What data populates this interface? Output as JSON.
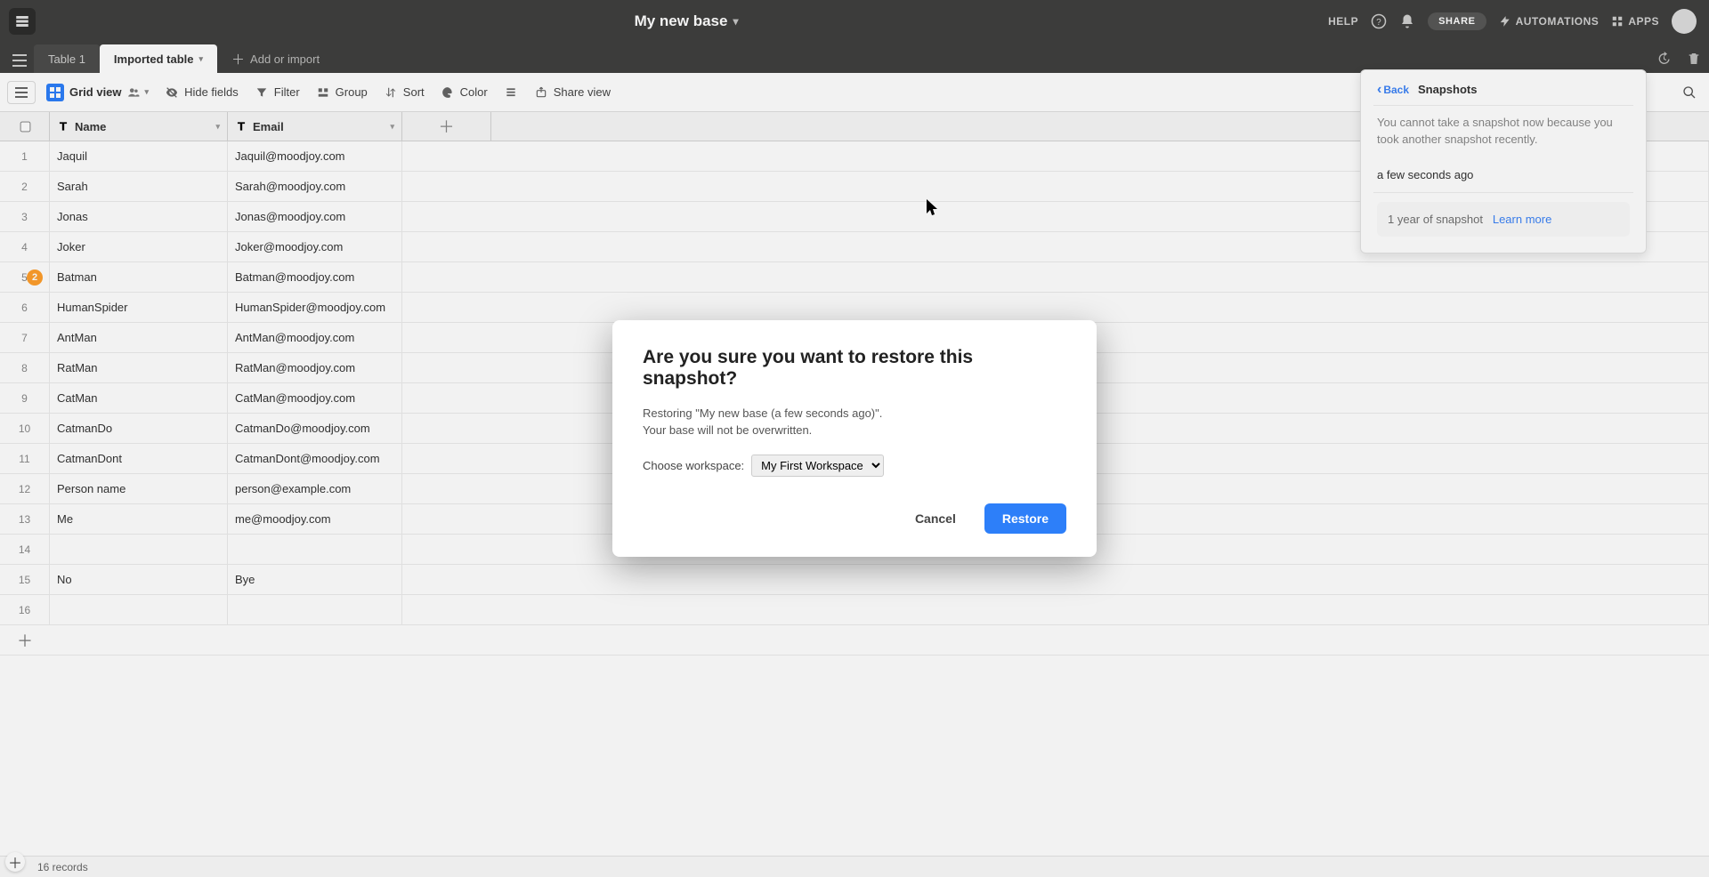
{
  "top": {
    "base_name": "My new base",
    "help": "HELP",
    "share": "SHARE",
    "automations": "AUTOMATIONS",
    "apps": "APPS"
  },
  "tabs": {
    "items": [
      {
        "label": "Table 1",
        "active": false
      },
      {
        "label": "Imported table",
        "active": true
      }
    ],
    "add_label": "Add or import"
  },
  "toolbar": {
    "view_name": "Grid view",
    "hide_fields": "Hide fields",
    "filter": "Filter",
    "group": "Group",
    "sort": "Sort",
    "color": "Color",
    "share_view": "Share view"
  },
  "columns": {
    "name": "Name",
    "email": "Email"
  },
  "rows": [
    {
      "n": 1,
      "name": "Jaquil",
      "email": "Jaquil@moodjoy.com"
    },
    {
      "n": 2,
      "name": "Sarah",
      "email": "Sarah@moodjoy.com"
    },
    {
      "n": 3,
      "name": "Jonas",
      "email": "Jonas@moodjoy.com"
    },
    {
      "n": 4,
      "name": "Joker",
      "email": "Joker@moodjoy.com"
    },
    {
      "n": 5,
      "name": "Batman",
      "email": "Batman@moodjoy.com",
      "badge": "2"
    },
    {
      "n": 6,
      "name": "HumanSpider",
      "email": "HumanSpider@moodjoy.com"
    },
    {
      "n": 7,
      "name": "AntMan",
      "email": "AntMan@moodjoy.com"
    },
    {
      "n": 8,
      "name": "RatMan",
      "email": "RatMan@moodjoy.com"
    },
    {
      "n": 9,
      "name": "CatMan",
      "email": "CatMan@moodjoy.com"
    },
    {
      "n": 10,
      "name": "CatmanDo",
      "email": "CatmanDo@moodjoy.com"
    },
    {
      "n": 11,
      "name": "CatmanDont",
      "email": "CatmanDont@moodjoy.com"
    },
    {
      "n": 12,
      "name": "Person name",
      "email": "person@example.com"
    },
    {
      "n": 13,
      "name": "Me",
      "email": "me@moodjoy.com"
    },
    {
      "n": 14,
      "name": "",
      "email": ""
    },
    {
      "n": 15,
      "name": "No",
      "email": "Bye"
    },
    {
      "n": 16,
      "name": "",
      "email": ""
    }
  ],
  "footer": {
    "records": "16 records"
  },
  "panel": {
    "back": "Back",
    "title": "Snapshots",
    "note": "You cannot take a snapshot now because you took another snapshot recently.",
    "timestamp": "a few seconds ago",
    "upsell_prefix": "1 year of snapshot",
    "upsell_learn": "Learn more"
  },
  "modal": {
    "title": "Are you sure you want to restore this snapshot?",
    "body_line1": "Restoring \"My new base (a few seconds ago)\".",
    "body_line2": "Your base will not be overwritten.",
    "choose_label": "Choose workspace:",
    "workspace": "My First Workspace",
    "cancel": "Cancel",
    "restore": "Restore"
  }
}
